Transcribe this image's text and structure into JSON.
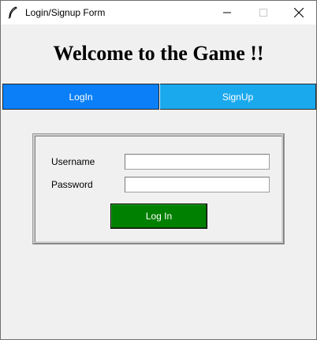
{
  "window": {
    "title": "Login/Signup Form",
    "icon": "feather-icon"
  },
  "heading": "Welcome to the Game !!",
  "tabs": {
    "login_label": "LogIn",
    "signup_label": "SignUp",
    "login_color": "#0a7ff7",
    "signup_color": "#1ba9ee"
  },
  "form": {
    "username_label": "Username",
    "username_value": "",
    "password_label": "Password",
    "password_value": "",
    "submit_label": "Log In",
    "submit_color": "#008000"
  }
}
